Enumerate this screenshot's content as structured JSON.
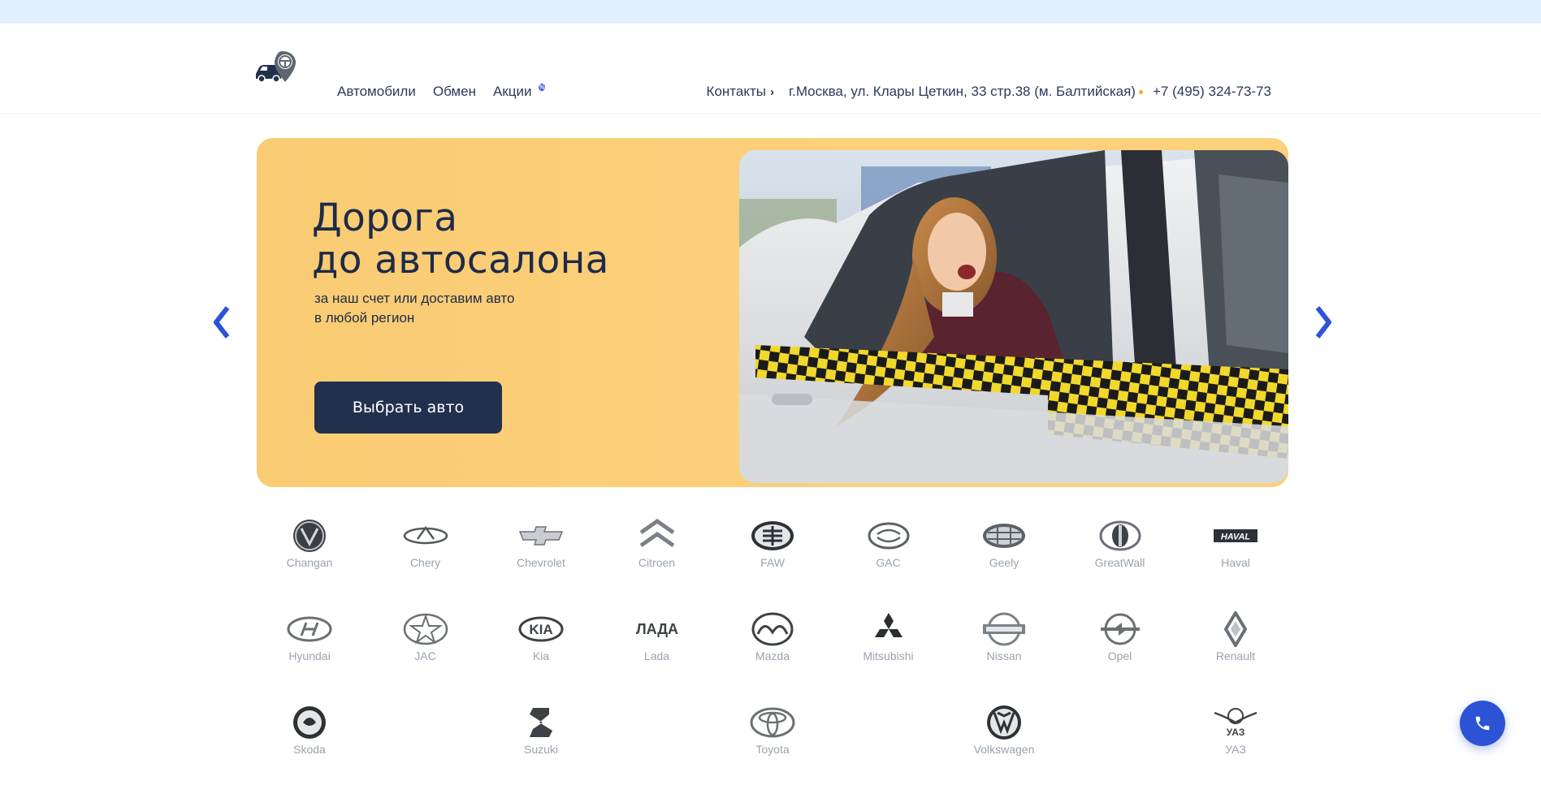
{
  "header": {
    "nav": [
      {
        "label": "Автомобили"
      },
      {
        "label": "Обмен"
      },
      {
        "label": "Акции",
        "badge": "%"
      }
    ],
    "contacts_label": "Контакты",
    "address": "г.Москва, ул. Клары Цеткин, 33 стр.38 (м. Балтийская)",
    "phone": "+7 (495) 324-73-73"
  },
  "banner": {
    "title_line1": "Дорога",
    "title_line2": "до автосалона",
    "subtitle_line1": "за наш счет или доставим авто",
    "subtitle_line2": "в любой регион",
    "button_label": "Выбрать авто"
  },
  "brands": {
    "row1": [
      "Changan",
      "Chery",
      "Chevrolet",
      "Citroen",
      "FAW",
      "GAC",
      "Geely",
      "GreatWall",
      "Haval"
    ],
    "row2": [
      "Hyundai",
      "JAC",
      "Kia",
      "Lada",
      "Mazda",
      "Mitsubishi",
      "Nissan",
      "Opel",
      "Renault"
    ],
    "row3": [
      "Skoda",
      "",
      "Suzuki",
      "",
      "Toyota",
      "",
      "Volkswagen",
      "",
      "УАЗ"
    ]
  },
  "logo_text": {
    "kia": "KIA",
    "lada": "ЛАДА",
    "haval": "HAVAL",
    "uaz": "УАЗ"
  },
  "colors": {
    "accent": "#2c53d6",
    "banner": "#fdd07c",
    "button": "#23304d",
    "topbar": "#e2effd"
  }
}
